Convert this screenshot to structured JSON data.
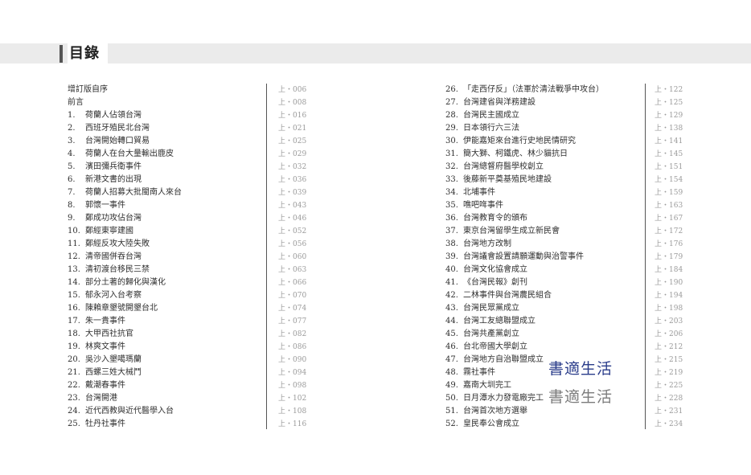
{
  "header": {
    "title": "目錄"
  },
  "left_entries": [
    {
      "num": "",
      "title": "增訂版自序",
      "page": "上・006"
    },
    {
      "num": "",
      "title": "前言",
      "page": "上・008"
    },
    {
      "num": "1.",
      "title": "荷蘭人佔領台灣",
      "page": "上・016"
    },
    {
      "num": "2.",
      "title": "西班牙殖民北台灣",
      "page": "上・021"
    },
    {
      "num": "3.",
      "title": "台灣開始轉口貿易",
      "page": "上・025"
    },
    {
      "num": "4.",
      "title": "荷蘭人在台大量輸出鹿皮",
      "page": "上・029"
    },
    {
      "num": "5.",
      "title": "濱田彌兵衛事件",
      "page": "上・032"
    },
    {
      "num": "6.",
      "title": "新港文書的出現",
      "page": "上・036"
    },
    {
      "num": "7.",
      "title": "荷蘭人招募大批閩南人來台",
      "page": "上・039"
    },
    {
      "num": "8.",
      "title": "郭懷一事件",
      "page": "上・043"
    },
    {
      "num": "9.",
      "title": "鄭成功攻佔台灣",
      "page": "上・046"
    },
    {
      "num": "10.",
      "title": "鄭經東寧建國",
      "page": "上・052"
    },
    {
      "num": "11.",
      "title": "鄭經反攻大陸失敗",
      "page": "上・056"
    },
    {
      "num": "12.",
      "title": "清帝國併吞台灣",
      "page": "上・060"
    },
    {
      "num": "13.",
      "title": "清初渡台移民三禁",
      "page": "上・063"
    },
    {
      "num": "14.",
      "title": "部分土著的歸化與漢化",
      "page": "上・066"
    },
    {
      "num": "15.",
      "title": "郁永河入台考察",
      "page": "上・070"
    },
    {
      "num": "16.",
      "title": "陳賴章墾號開墾台北",
      "page": "上・074"
    },
    {
      "num": "17.",
      "title": "朱一貴事件",
      "page": "上・077"
    },
    {
      "num": "18.",
      "title": "大甲西社抗官",
      "page": "上・082"
    },
    {
      "num": "19.",
      "title": "林爽文事件",
      "page": "上・086"
    },
    {
      "num": "20.",
      "title": "吳沙入墾噶瑪蘭",
      "page": "上・090"
    },
    {
      "num": "21.",
      "title": "西螺三姓大械鬥",
      "page": "上・094"
    },
    {
      "num": "22.",
      "title": "戴潮春事件",
      "page": "上・098"
    },
    {
      "num": "23.",
      "title": "台灣開港",
      "page": "上・102"
    },
    {
      "num": "24.",
      "title": "近代西教與近代醫學入台",
      "page": "上・108"
    },
    {
      "num": "25.",
      "title": "牡丹社事件",
      "page": "上・116"
    }
  ],
  "right_entries": [
    {
      "num": "26.",
      "title": "「走西仔反」（法軍於清法戰爭中攻台）",
      "page": "上・122"
    },
    {
      "num": "27.",
      "title": "台灣建省與洋務建設",
      "page": "上・125"
    },
    {
      "num": "28.",
      "title": "台灣民主國成立",
      "page": "上・129"
    },
    {
      "num": "29.",
      "title": "日本領行六三法",
      "page": "上・138"
    },
    {
      "num": "30.",
      "title": "伊能嘉矩來台進行史地民情研究",
      "page": "上・141"
    },
    {
      "num": "31.",
      "title": "簡大獅、柯鐵虎、林少貓抗日",
      "page": "上・145"
    },
    {
      "num": "32.",
      "title": "台灣總督府醫學校創立",
      "page": "上・151"
    },
    {
      "num": "33.",
      "title": "後藤新平奠基殖民地建設",
      "page": "上・154"
    },
    {
      "num": "34.",
      "title": "北埔事件",
      "page": "上・159"
    },
    {
      "num": "35.",
      "title": "噍吧哖事件",
      "page": "上・163"
    },
    {
      "num": "36.",
      "title": "台灣教育令的頒布",
      "page": "上・167"
    },
    {
      "num": "37.",
      "title": "東京台灣留學生成立新民會",
      "page": "上・172"
    },
    {
      "num": "38.",
      "title": "台灣地方改制",
      "page": "上・176"
    },
    {
      "num": "39.",
      "title": "台灣議會設置請願運動與治警事件",
      "page": "上・179"
    },
    {
      "num": "40.",
      "title": "台灣文化協會成立",
      "page": "上・184"
    },
    {
      "num": "41.",
      "title": "《台灣民報》創刊",
      "page": "上・190"
    },
    {
      "num": "42.",
      "title": "二林事件與台灣農民組合",
      "page": "上・194"
    },
    {
      "num": "43.",
      "title": "台灣民眾黨成立",
      "page": "上・198"
    },
    {
      "num": "44.",
      "title": "台灣工友總聯盟成立",
      "page": "上・203"
    },
    {
      "num": "45.",
      "title": "台灣共產黨創立",
      "page": "上・206"
    },
    {
      "num": "46.",
      "title": "台北帝國大學創立",
      "page": "上・212"
    },
    {
      "num": "47.",
      "title": "台灣地方自治聯盟成立",
      "page": "上・215"
    },
    {
      "num": "48.",
      "title": "霧社事件",
      "page": "上・219"
    },
    {
      "num": "49.",
      "title": "嘉南大圳完工",
      "page": "上・225"
    },
    {
      "num": "50.",
      "title": "日月潭水力發電廠完工",
      "page": "上・228"
    },
    {
      "num": "51.",
      "title": "台灣首次地方選舉",
      "page": "上・231"
    },
    {
      "num": "52.",
      "title": "皇民奉公會成立",
      "page": "上・234"
    }
  ],
  "watermark": {
    "primary": "書適生活",
    "secondary": "書適生活",
    "primary_color": "#2a3c8a",
    "secondary_color": "#7c7c7c"
  }
}
